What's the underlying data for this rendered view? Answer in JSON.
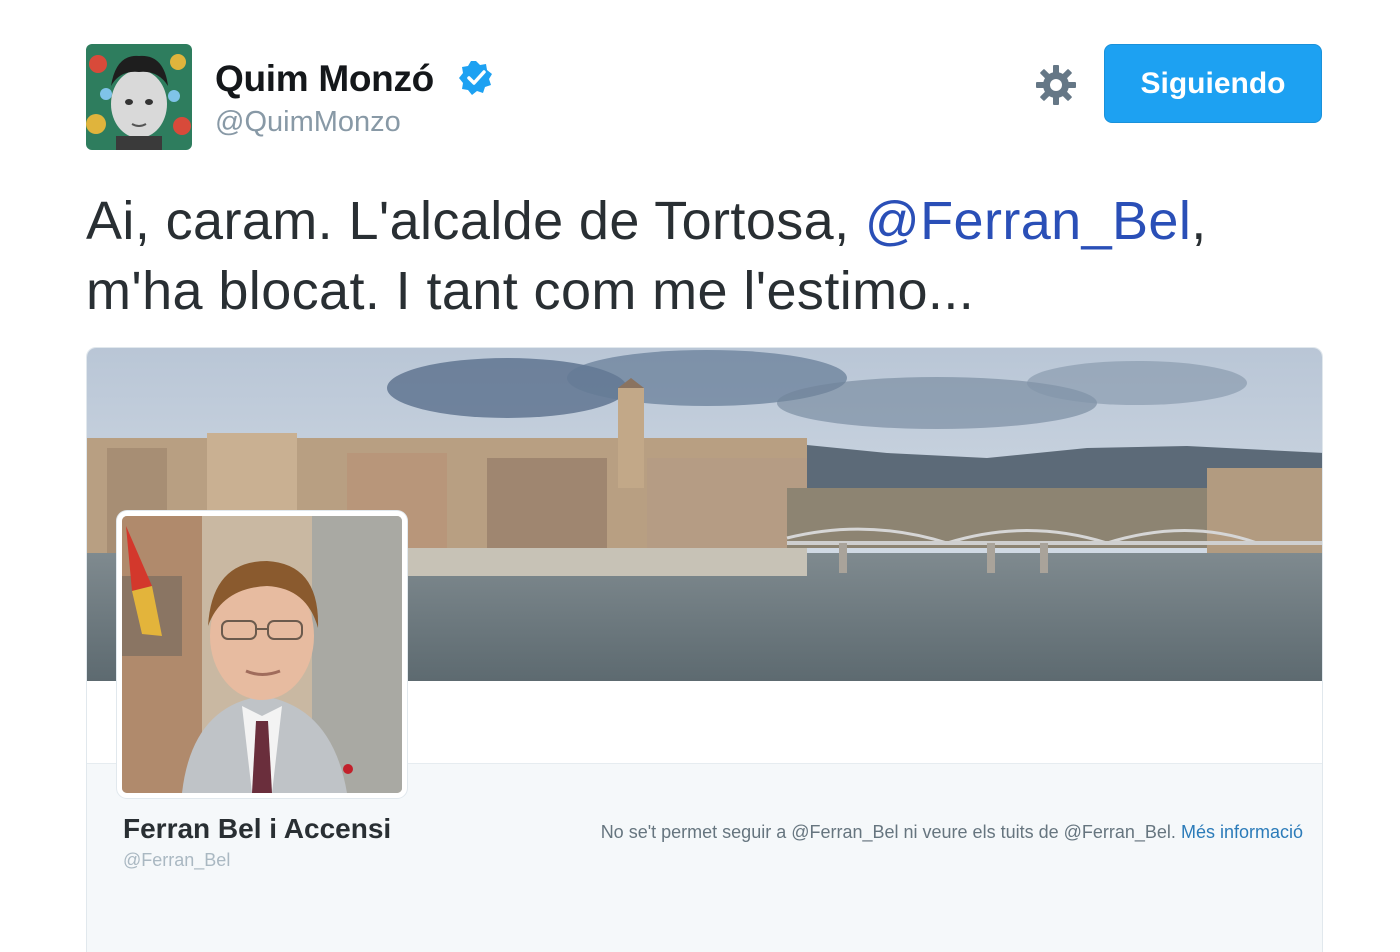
{
  "author": {
    "name": "Quim Monzó",
    "handle": "@QuimMonzo",
    "verified": true
  },
  "actions": {
    "follow_label": "Siguiendo"
  },
  "tweet": {
    "text_before": "Ai, caram. L'alcalde de Tortosa, ",
    "mention": "@Ferran_Bel",
    "text_after": ", m'ha blocat. I tant com me l'estimo..."
  },
  "card": {
    "name": "Ferran Bel i Accensi",
    "handle": "@Ferran_Bel",
    "notice": "No se't permet seguir a @Ferran_Bel ni veure els tuits de @Ferran_Bel.",
    "more_info": "Més informació"
  },
  "colors": {
    "accent": "#1da1f2",
    "mention": "#2a4fb7",
    "text": "#292f33",
    "muted": "#8899a6"
  },
  "icons": [
    "verified-badge-icon",
    "gear-icon"
  ]
}
